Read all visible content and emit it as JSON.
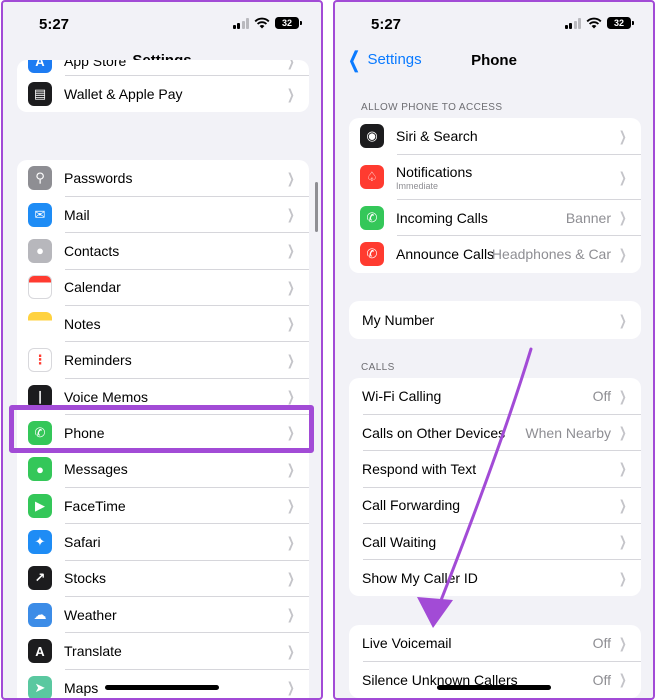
{
  "status": {
    "time": "5:27",
    "battery": "32"
  },
  "left": {
    "title": "Settings",
    "group1": [
      {
        "label": "App Store",
        "icon": "app-store-icon",
        "color": "#1e7cf2"
      },
      {
        "label": "Wallet & Apple Pay",
        "icon": "wallet-icon",
        "color": "#1c1c1e"
      }
    ],
    "group2": [
      {
        "label": "Passwords",
        "icon": "key-icon",
        "color": "#8e8e93"
      },
      {
        "label": "Mail",
        "icon": "mail-icon",
        "color": "#1e8cf5"
      },
      {
        "label": "Contacts",
        "icon": "contacts-icon",
        "color": "#b7b7bc"
      },
      {
        "label": "Calendar",
        "icon": "calendar-icon",
        "color": "#ffffff"
      },
      {
        "label": "Notes",
        "icon": "notes-icon",
        "color": "#ffd23f"
      },
      {
        "label": "Reminders",
        "icon": "reminders-icon",
        "color": "#ffffff"
      },
      {
        "label": "Voice Memos",
        "icon": "voice-memos-icon",
        "color": "#1c1c1e"
      },
      {
        "label": "Phone",
        "icon": "phone-icon",
        "color": "#34c759"
      },
      {
        "label": "Messages",
        "icon": "messages-icon",
        "color": "#34c759"
      },
      {
        "label": "FaceTime",
        "icon": "facetime-icon",
        "color": "#34c759"
      },
      {
        "label": "Safari",
        "icon": "safari-icon",
        "color": "#1e8cf5"
      },
      {
        "label": "Stocks",
        "icon": "stocks-icon",
        "color": "#1c1c1e"
      },
      {
        "label": "Weather",
        "icon": "weather-icon",
        "color": "#3c8ce7"
      },
      {
        "label": "Translate",
        "icon": "translate-icon",
        "color": "#1c1c1e"
      },
      {
        "label": "Maps",
        "icon": "maps-icon",
        "color": "#5ac8a0"
      }
    ]
  },
  "right": {
    "back_label": "Settings",
    "title": "Phone",
    "section_access": "ALLOW PHONE TO ACCESS",
    "access": [
      {
        "label": "Siri & Search",
        "sub": "",
        "value": "",
        "icon": "siri-icon",
        "color": "#1c1c1e"
      },
      {
        "label": "Notifications",
        "sub": "Immediate",
        "value": "",
        "icon": "notifications-icon",
        "color": "#ff3b30"
      },
      {
        "label": "Incoming Calls",
        "sub": "",
        "value": "Banner",
        "icon": "incoming-calls-icon",
        "color": "#34c759"
      },
      {
        "label": "Announce Calls",
        "sub": "",
        "value": "Headphones & Car",
        "icon": "announce-calls-icon",
        "color": "#ff3b30"
      }
    ],
    "my_number": "My Number",
    "section_calls": "CALLS",
    "calls": [
      {
        "label": "Wi-Fi Calling",
        "value": "Off"
      },
      {
        "label": "Calls on Other Devices",
        "value": "When Nearby"
      },
      {
        "label": "Respond with Text",
        "value": ""
      },
      {
        "label": "Call Forwarding",
        "value": ""
      },
      {
        "label": "Call Waiting",
        "value": ""
      },
      {
        "label": "Show My Caller ID",
        "value": ""
      }
    ],
    "voicemail": [
      {
        "label": "Live Voicemail",
        "value": "Off"
      },
      {
        "label": "Silence Unknown Callers",
        "value": "Off"
      }
    ]
  },
  "accent": "#a24bd6"
}
